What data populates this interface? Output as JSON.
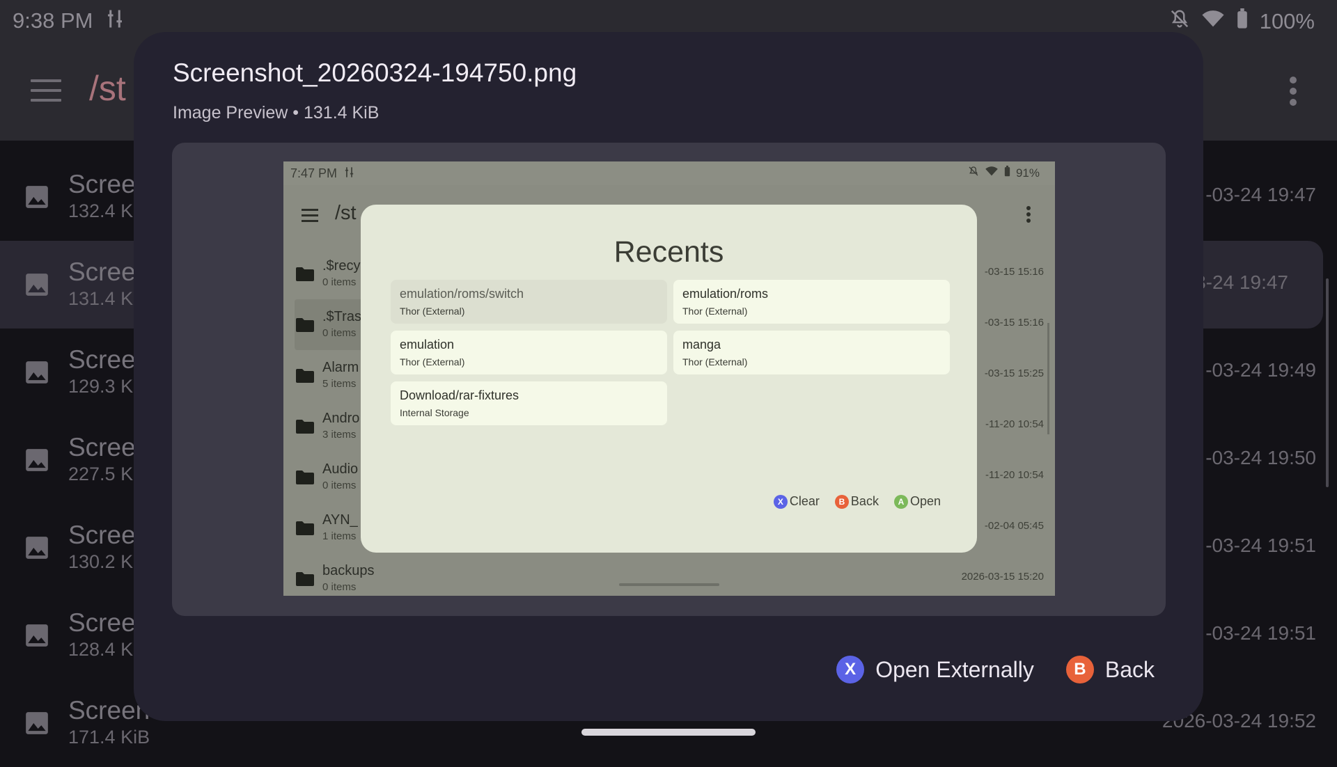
{
  "status_bar": {
    "time": "9:38 PM",
    "battery": "100%"
  },
  "app_bar": {
    "path": "/st"
  },
  "background_list": [
    {
      "name": "Scree",
      "size": "132.4 K",
      "date": "-03-24 19:47",
      "selected": false
    },
    {
      "name": "Scree",
      "size": "131.4 K",
      "date": "-03-24 19:47",
      "selected": true
    },
    {
      "name": "Scree",
      "size": "129.3 K",
      "date": "-03-24 19:49",
      "selected": false
    },
    {
      "name": "Scree",
      "size": "227.5 K",
      "date": "-03-24 19:50",
      "selected": false
    },
    {
      "name": "Scree",
      "size": "130.2 K",
      "date": "-03-24 19:51",
      "selected": false
    },
    {
      "name": "Scree",
      "size": "128.4 K",
      "date": "-03-24 19:51",
      "selected": false
    },
    {
      "name": "Screen",
      "size": "171.4 KiB",
      "date": "2026-03-24 19:52",
      "selected": false
    }
  ],
  "dialog": {
    "title": "Screenshot_20260324-194750.png",
    "subtitle": "Image Preview • 131.4 KiB",
    "actions": {
      "open_externally": {
        "button": "X",
        "label": "Open Externally",
        "color": "#5b63e6"
      },
      "back": {
        "button": "B",
        "label": "Back",
        "color": "#e8623a"
      }
    }
  },
  "preview": {
    "status_bar": {
      "time": "7:47 PM",
      "battery": "91%"
    },
    "path": "/st",
    "files": [
      {
        "name": ".$recy",
        "count": "0 items",
        "date": "-03-15 15:16"
      },
      {
        "name": ".$Tras",
        "count": "0 items",
        "date": "-03-15 15:16"
      },
      {
        "name": "Alarm",
        "count": "5 items",
        "date": "-03-15 15:25"
      },
      {
        "name": "Andro",
        "count": "3 items",
        "date": "-11-20 10:54"
      },
      {
        "name": "Audio",
        "count": "0 items",
        "date": "-11-20 10:54"
      },
      {
        "name": "AYN_",
        "count": "1 items",
        "date": "-02-04 05:45"
      },
      {
        "name": "backups",
        "count": "0 items",
        "date": "2026-03-15 15:20"
      }
    ],
    "recents": {
      "title": "Recents",
      "items": [
        {
          "path": "emulation/roms/switch",
          "location": "Thor (External)"
        },
        {
          "path": "emulation/roms",
          "location": "Thor (External)"
        },
        {
          "path": "emulation",
          "location": "Thor (External)"
        },
        {
          "path": "manga",
          "location": "Thor (External)"
        },
        {
          "path": "Download/rar-fixtures",
          "location": "Internal Storage"
        }
      ],
      "actions": {
        "clear": {
          "button": "X",
          "label": "Clear",
          "color": "#5b63e6"
        },
        "back": {
          "button": "B",
          "label": "Back",
          "color": "#e8623a"
        },
        "open": {
          "button": "A",
          "label": "Open",
          "color": "#7cb95a"
        }
      }
    }
  }
}
